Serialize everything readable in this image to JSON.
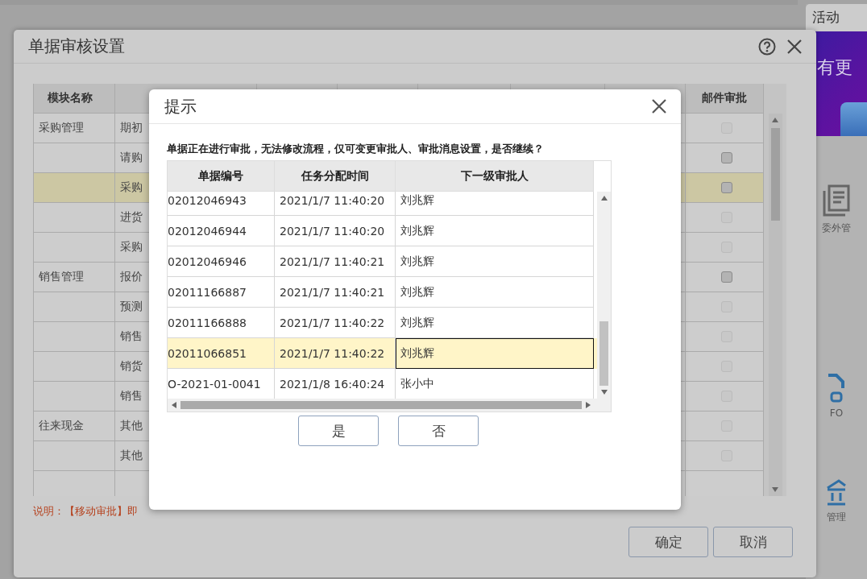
{
  "background": {
    "panel_title": "活动",
    "banner_text": "有更",
    "tiles": [
      {
        "kind": "stack",
        "label": "委外管"
      },
      {
        "kind": "file",
        "label": "FO"
      },
      {
        "kind": "bank",
        "label": "管理"
      }
    ]
  },
  "settings_dialog": {
    "title": "单据审核设置",
    "columns": [
      "模块名称",
      "邮件审批"
    ],
    "rows": [
      {
        "module": "采购管理",
        "document": "期初",
        "mail_approval": {
          "disabled": true
        },
        "selected": false
      },
      {
        "module": "",
        "document": "请购",
        "mail_approval": {
          "disabled": false
        },
        "selected": false
      },
      {
        "module": "",
        "document": "采购",
        "mail_approval": {
          "disabled": false
        },
        "selected": true
      },
      {
        "module": "",
        "document": "进货",
        "mail_approval": {
          "disabled": true
        },
        "selected": false
      },
      {
        "module": "",
        "document": "采购",
        "mail_approval": {
          "disabled": true
        },
        "selected": false
      },
      {
        "module": "销售管理",
        "document": "报价",
        "mail_approval": {
          "disabled": false
        },
        "selected": false
      },
      {
        "module": "",
        "document": "预测",
        "mail_approval": {
          "disabled": true
        },
        "selected": false
      },
      {
        "module": "",
        "document": "销售",
        "mail_approval": {
          "disabled": true
        },
        "selected": false
      },
      {
        "module": "",
        "document": "销货",
        "mail_approval": {
          "disabled": true
        },
        "selected": false
      },
      {
        "module": "",
        "document": "销售",
        "mail_approval": {
          "disabled": true
        },
        "selected": false
      },
      {
        "module": "往来现金",
        "document": "其他",
        "mail_approval": {
          "disabled": true
        },
        "selected": false
      },
      {
        "module": "",
        "document": "其他",
        "mail_approval": {
          "disabled": true
        },
        "selected": false
      }
    ],
    "note": "说明：【移动审批】即",
    "buttons": [
      "确定",
      "取消"
    ]
  },
  "prompt_dialog": {
    "title": "提示",
    "message": "单据正在进行审批，无法修改流程，仅可变更审批人、审批消息设置，是否继续？",
    "columns": [
      "单据编号",
      "任务分配时间",
      "下一级审批人"
    ],
    "rows": [
      {
        "number": "02012046943",
        "time": "2021/1/7 11:40:20",
        "approver": "刘兆辉",
        "selected": false
      },
      {
        "number": "02012046944",
        "time": "2021/1/7 11:40:20",
        "approver": "刘兆辉",
        "selected": false
      },
      {
        "number": "02012046946",
        "time": "2021/1/7 11:40:21",
        "approver": "刘兆辉",
        "selected": false
      },
      {
        "number": "02011166887",
        "time": "2021/1/7 11:40:21",
        "approver": "刘兆辉",
        "selected": false
      },
      {
        "number": "02011166888",
        "time": "2021/1/7 11:40:22",
        "approver": "刘兆辉",
        "selected": false
      },
      {
        "number": "02011066851",
        "time": "2021/1/7 11:40:22",
        "approver": "刘兆辉",
        "selected": true
      },
      {
        "number": "O-2021-01-0041",
        "time": "2021/1/8 16:40:24",
        "approver": "张小中",
        "selected": false
      }
    ],
    "buttons": [
      "是",
      "否"
    ]
  }
}
